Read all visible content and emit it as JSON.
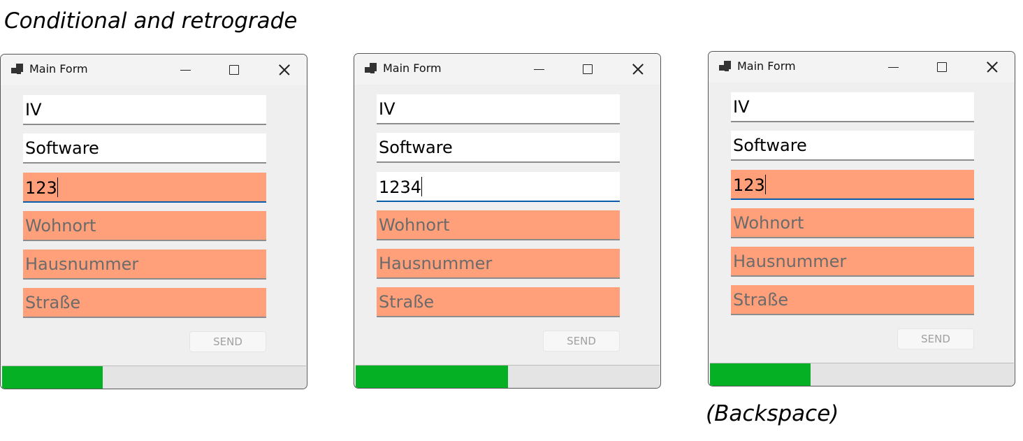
{
  "caption_top": "Conditional and retrograde",
  "caption_bottom": "(Backspace)",
  "colors": {
    "invalid": "#ffa07a",
    "progress": "#06b025",
    "focus": "#0b5cad"
  },
  "windows": [
    {
      "title": "Main Form",
      "fields": [
        {
          "value": "IV",
          "placeholder": "",
          "invalid": false
        },
        {
          "value": "Software",
          "placeholder": "",
          "invalid": false
        },
        {
          "value": "123",
          "placeholder": "",
          "invalid": true,
          "focused": true
        },
        {
          "value": "",
          "placeholder": "Wohnort",
          "invalid": true
        },
        {
          "value": "",
          "placeholder": "Hausnummer",
          "invalid": true
        },
        {
          "value": "",
          "placeholder": "Straße",
          "invalid": true
        }
      ],
      "send_label": "SEND",
      "progress": 0.33
    },
    {
      "title": "Main Form",
      "fields": [
        {
          "value": "IV",
          "placeholder": "",
          "invalid": false
        },
        {
          "value": "Software",
          "placeholder": "",
          "invalid": false
        },
        {
          "value": "1234",
          "placeholder": "",
          "invalid": false,
          "focused": true
        },
        {
          "value": "",
          "placeholder": "Wohnort",
          "invalid": true
        },
        {
          "value": "",
          "placeholder": "Hausnummer",
          "invalid": true
        },
        {
          "value": "",
          "placeholder": "Straße",
          "invalid": true
        }
      ],
      "send_label": "SEND",
      "progress": 0.5
    },
    {
      "title": "Main Form",
      "fields": [
        {
          "value": "IV",
          "placeholder": "",
          "invalid": false
        },
        {
          "value": "Software",
          "placeholder": "",
          "invalid": false
        },
        {
          "value": "123",
          "placeholder": "",
          "invalid": true,
          "focused": true
        },
        {
          "value": "",
          "placeholder": "Wohnort",
          "invalid": true
        },
        {
          "value": "",
          "placeholder": "Hausnummer",
          "invalid": true
        },
        {
          "value": "",
          "placeholder": "Straße",
          "invalid": true
        }
      ],
      "send_label": "SEND",
      "progress": 0.33
    }
  ]
}
